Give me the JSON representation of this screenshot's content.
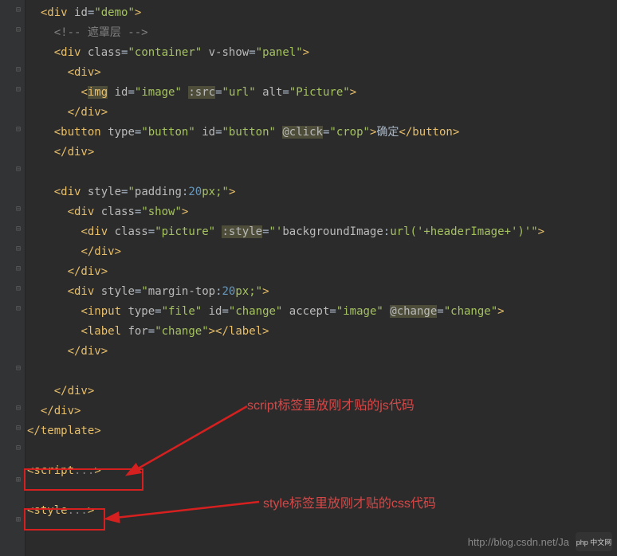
{
  "code": {
    "l1": "<div id=\"demo\">",
    "l2": "<!-- 遮罩层 -->",
    "l3a": "<div class=\"container\" v-show=\"panel\">",
    "l4": "<div>",
    "l5": "<img id=\"image\" :src=\"url\" alt=\"Picture\">",
    "l6": "</div>",
    "l7a": "<button type=\"button\" id=\"button\" @click=\"crop\">确定</button>",
    "l8": "</div>",
    "l9": "<div style=\"padding:20px;\">",
    "l10": "<div class=\"show\">",
    "l11": "<div class=\"picture\" :style=\"'backgroundImage:url('+headerImage+')'\">",
    "l12": "</div>",
    "l13": "</div>",
    "l14": "<div style=\"margin-top:20px;\">",
    "l15": "<input type=\"file\" id=\"change\" accept=\"image\" @change=\"change\">",
    "l16": "<label for=\"change\"></label>",
    "l17": "</div>",
    "l18": "</div>",
    "l19": "</div>",
    "l20": "</template>",
    "l21": "<script...>",
    "l22": "<style...>"
  },
  "annotations": {
    "script_note": "script标签里放刚才贴的js代码",
    "style_note": "style标签里放刚才贴的css代码"
  },
  "watermark": "http://blog.csdn.net/Ja",
  "logo": "php 中文网"
}
